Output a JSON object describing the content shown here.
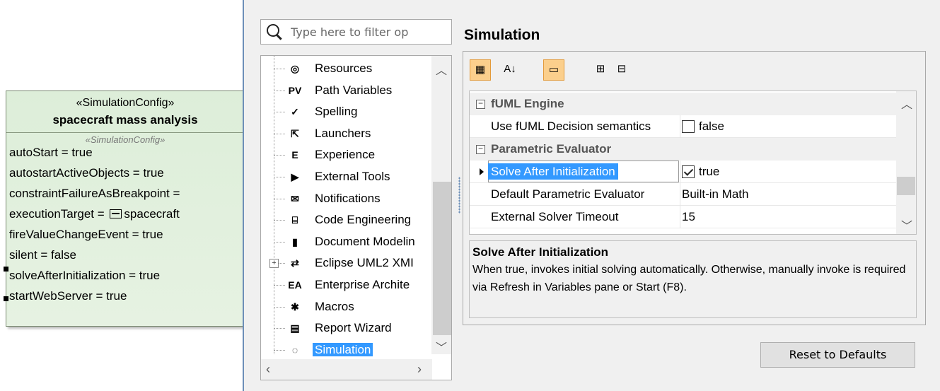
{
  "block": {
    "stereotype": "«SimulationConfig»",
    "name": "spacecraft mass analysis",
    "sub_stereotype": "«SimulationConfig»",
    "attributes": [
      "autoStart = true",
      "autostartActiveObjects = true",
      "constraintFailureAsBreakpoint =",
      "executionTarget = ",
      "fireValueChangeEvent = true",
      "silent = false",
      "solveAfterInitialization = true",
      "startWebServer = true"
    ],
    "execution_target_value": "spacecraft"
  },
  "filter": {
    "placeholder": "Type here to filter op"
  },
  "tree": {
    "items": [
      {
        "label": "Resources",
        "icon": "gear-circle-icon",
        "glyph": "◎"
      },
      {
        "label": "Path Variables",
        "icon": "pv-icon",
        "glyph": "PV"
      },
      {
        "label": "Spelling",
        "icon": "spellcheck-icon",
        "glyph": "✓"
      },
      {
        "label": "Launchers",
        "icon": "launcher-icon",
        "glyph": "⇱"
      },
      {
        "label": "Experience",
        "icon": "experience-icon",
        "glyph": "E"
      },
      {
        "label": "External Tools",
        "icon": "external-tools-icon",
        "glyph": "▶"
      },
      {
        "label": "Notifications",
        "icon": "envelope-icon",
        "glyph": "✉"
      },
      {
        "label": "Code Engineering",
        "icon": "code-engineering-icon",
        "glyph": "⌸"
      },
      {
        "label": "Document Modelin",
        "icon": "document-icon",
        "glyph": "▮"
      },
      {
        "label": "Eclipse UML2 XMI",
        "icon": "eclipse-arrows-icon",
        "glyph": "⇄"
      },
      {
        "label": "Enterprise Archite",
        "icon": "ea-icon",
        "glyph": "EA"
      },
      {
        "label": "Macros",
        "icon": "macros-gear-icon",
        "glyph": "✱"
      },
      {
        "label": "Report Wizard",
        "icon": "report-icon",
        "glyph": "▤"
      },
      {
        "label": "Simulation",
        "icon": "simulation-icon",
        "glyph": "◌"
      }
    ],
    "selected": "Simulation"
  },
  "title": "Simulation",
  "toolbar": [
    {
      "icon": "categorized-view-icon",
      "glyph": "▦",
      "on": true
    },
    {
      "icon": "sort-alphabetical-icon",
      "glyph": "A↓",
      "on": false
    },
    {
      "icon": "show-description-icon",
      "glyph": "▭",
      "on": true
    },
    {
      "icon": "expand-all-icon",
      "glyph": "⊞",
      "on": false
    },
    {
      "icon": "collapse-all-icon",
      "glyph": "⊟",
      "on": false
    }
  ],
  "grid": {
    "categories": [
      {
        "name": "fUML Engine",
        "rows": [
          {
            "key": "Use fUML Decision semantics",
            "type": "checkbox",
            "checked": false,
            "value": "false"
          }
        ]
      },
      {
        "name": "Parametric Evaluator",
        "rows": [
          {
            "key": "Solve After Initialization",
            "type": "checkbox",
            "checked": true,
            "value": "true",
            "selected": true
          },
          {
            "key": "Default Parametric Evaluator",
            "type": "text",
            "value": "Built-in Math"
          },
          {
            "key": "External Solver Timeout",
            "type": "text",
            "value": "15"
          }
        ]
      }
    ]
  },
  "description": {
    "title": "Solve After Initialization",
    "body": "When true, invokes initial solving automatically. Otherwise, manually invoke is required via Refresh in Variables pane or Start (F8)."
  },
  "reset_label": "Reset to Defaults",
  "colors": {
    "selection": "#3399ff",
    "toggle_on": "#fbcf8c",
    "block_fill": "#ddeed9"
  }
}
